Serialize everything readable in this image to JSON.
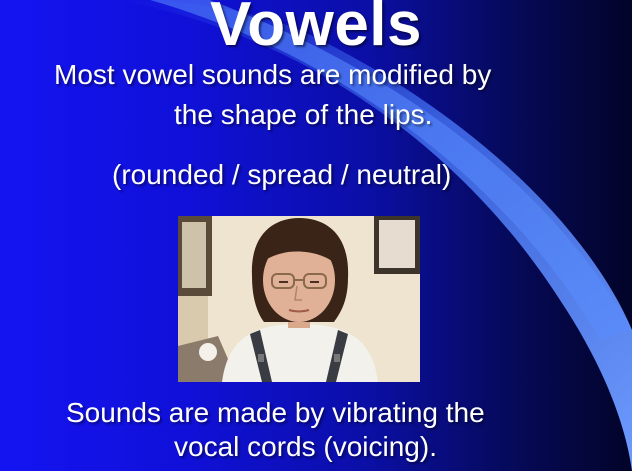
{
  "slide": {
    "title": "Vowels",
    "line1": "Most vowel sounds are modified by",
    "line2": "the shape of the lips.",
    "line3": "(rounded / spread / neutral)",
    "line4": "Sounds are made by vibrating the",
    "line5": "vocal cords (voicing)."
  },
  "colors": {
    "background_left": "#1414f2",
    "background_right": "#020428",
    "swoosh": "#5a8cff",
    "text": "#ffffff"
  }
}
